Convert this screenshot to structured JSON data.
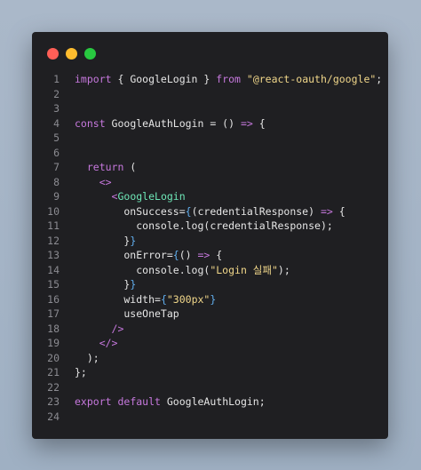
{
  "window": {
    "traffic_lights": [
      "close",
      "minimize",
      "maximize"
    ]
  },
  "code_lines": [
    {
      "n": "1",
      "segments": [
        {
          "t": "import",
          "c": "kw"
        },
        {
          "t": " { GoogleLogin } ",
          "c": "plain"
        },
        {
          "t": "from",
          "c": "kw"
        },
        {
          "t": " ",
          "c": "plain"
        },
        {
          "t": "\"@react-oauth/google\"",
          "c": "str"
        },
        {
          "t": ";",
          "c": "plain"
        }
      ]
    },
    {
      "n": "2",
      "segments": []
    },
    {
      "n": "3",
      "segments": []
    },
    {
      "n": "4",
      "segments": [
        {
          "t": "const",
          "c": "kw"
        },
        {
          "t": " GoogleAuthLogin = () ",
          "c": "plain"
        },
        {
          "t": "=>",
          "c": "arrow"
        },
        {
          "t": " {",
          "c": "plain"
        }
      ]
    },
    {
      "n": "5",
      "segments": []
    },
    {
      "n": "6",
      "segments": []
    },
    {
      "n": "7",
      "segments": [
        {
          "t": "  ",
          "c": "plain"
        },
        {
          "t": "return",
          "c": "kw"
        },
        {
          "t": " (",
          "c": "plain"
        }
      ]
    },
    {
      "n": "8",
      "segments": [
        {
          "t": "    ",
          "c": "plain"
        },
        {
          "t": "<>",
          "c": "tag"
        }
      ]
    },
    {
      "n": "9",
      "segments": [
        {
          "t": "      ",
          "c": "plain"
        },
        {
          "t": "<",
          "c": "tag"
        },
        {
          "t": "GoogleLogin",
          "c": "tagname"
        }
      ]
    },
    {
      "n": "10",
      "segments": [
        {
          "t": "        onSuccess=",
          "c": "plain"
        },
        {
          "t": "{",
          "c": "brace"
        },
        {
          "t": "(credentialResponse) ",
          "c": "plain"
        },
        {
          "t": "=>",
          "c": "arrow"
        },
        {
          "t": " {",
          "c": "plain"
        }
      ]
    },
    {
      "n": "11",
      "segments": [
        {
          "t": "          console.log(credentialResponse);",
          "c": "plain"
        }
      ]
    },
    {
      "n": "12",
      "segments": [
        {
          "t": "        }",
          "c": "plain"
        },
        {
          "t": "}",
          "c": "brace"
        }
      ]
    },
    {
      "n": "13",
      "segments": [
        {
          "t": "        onError=",
          "c": "plain"
        },
        {
          "t": "{",
          "c": "brace"
        },
        {
          "t": "() ",
          "c": "plain"
        },
        {
          "t": "=>",
          "c": "arrow"
        },
        {
          "t": " {",
          "c": "plain"
        }
      ]
    },
    {
      "n": "14",
      "segments": [
        {
          "t": "          console.log(",
          "c": "plain"
        },
        {
          "t": "\"Login 실패\"",
          "c": "str"
        },
        {
          "t": ");",
          "c": "plain"
        }
      ]
    },
    {
      "n": "15",
      "segments": [
        {
          "t": "        }",
          "c": "plain"
        },
        {
          "t": "}",
          "c": "brace"
        }
      ]
    },
    {
      "n": "16",
      "segments": [
        {
          "t": "        width=",
          "c": "plain"
        },
        {
          "t": "{",
          "c": "brace"
        },
        {
          "t": "\"300px\"",
          "c": "str"
        },
        {
          "t": "}",
          "c": "brace"
        }
      ]
    },
    {
      "n": "17",
      "segments": [
        {
          "t": "        useOneTap",
          "c": "plain"
        }
      ]
    },
    {
      "n": "18",
      "segments": [
        {
          "t": "      ",
          "c": "plain"
        },
        {
          "t": "/>",
          "c": "tag"
        }
      ]
    },
    {
      "n": "19",
      "segments": [
        {
          "t": "    ",
          "c": "plain"
        },
        {
          "t": "</>",
          "c": "tag"
        }
      ]
    },
    {
      "n": "20",
      "segments": [
        {
          "t": "  );",
          "c": "plain"
        }
      ]
    },
    {
      "n": "21",
      "segments": [
        {
          "t": "};",
          "c": "plain"
        }
      ]
    },
    {
      "n": "22",
      "segments": []
    },
    {
      "n": "23",
      "segments": [
        {
          "t": "export",
          "c": "kw"
        },
        {
          "t": " ",
          "c": "plain"
        },
        {
          "t": "default",
          "c": "kw"
        },
        {
          "t": " GoogleAuthLogin;",
          "c": "plain"
        }
      ]
    },
    {
      "n": "24",
      "segments": []
    }
  ]
}
